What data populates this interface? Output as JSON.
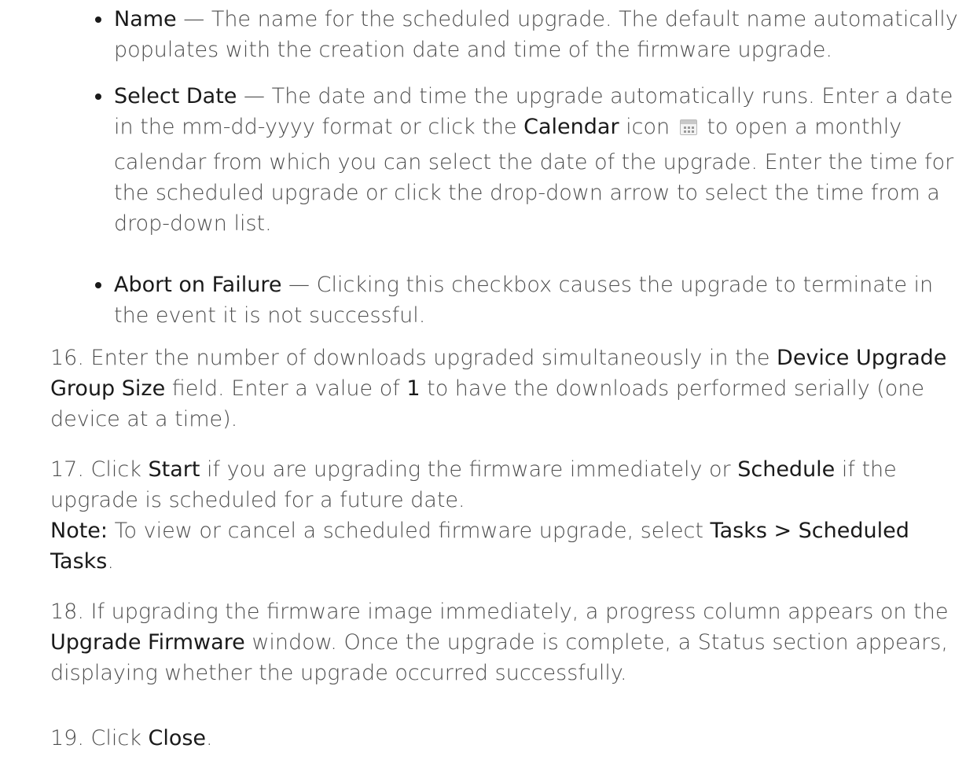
{
  "bullets": [
    {
      "term": "Name",
      "text": " — The name for the scheduled upgrade. The default name automatically populates with the creation date and time of the firmware upgrade."
    },
    {
      "term": "Select Date",
      "text_a": " — The date and time the upgrade automatically runs. Enter a date in the mm-dd-yyyy format or click the ",
      "calendar_term": "Calendar",
      "text_b": " icon",
      "text_c": " to open a monthly",
      "text_d": "calendar from which you can select the date of the upgrade. Enter the time for the scheduled upgrade or click the drop-down arrow to select the time from a drop-down list."
    },
    {
      "term": "Abort on Failure",
      "text": " — Clicking this checkbox causes the upgrade to terminate in the event it is not successful."
    }
  ],
  "steps": [
    {
      "num": "16.",
      "t1": "Enter the number of downloads upgraded simultaneously in the ",
      "b1": "Device Upgrade Group Size",
      "t2": " field. Enter a value of ",
      "b2": "1",
      "t3": " to have the downloads performed serially (one device at a time)."
    },
    {
      "num": "17.",
      "t1": "Click ",
      "b1": "Start",
      "t2": " if you are upgrading the firmware immediately or ",
      "b2": "Schedule",
      "t3": " if the upgrade is scheduled for a future date.",
      "note_label": "Note:",
      "note_t1": " To view or cancel a scheduled firmware upgrade, select ",
      "note_b1": "Tasks > Scheduled Tasks",
      "note_t2": "."
    },
    {
      "num": "18.",
      "t1": "If upgrading the firmware image immediately, a progress column appears on the ",
      "b1": "Upgrade Firmware",
      "t2": " window. Once the upgrade is complete, a Status section appears, displaying whether the upgrade occurred successfully."
    },
    {
      "num": "19.",
      "t1": "Click ",
      "b1": "Close",
      "t2": "."
    }
  ],
  "icons": {
    "calendar": "calendar-icon"
  }
}
